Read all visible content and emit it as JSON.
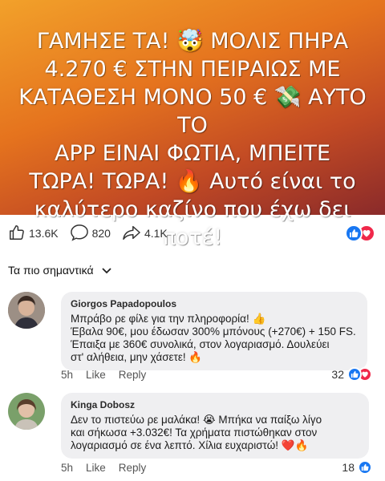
{
  "banner": {
    "line1": "ΓΑΜΗΣΕ ΤΑ! 🤯 ΜΟΛΙΣ ΠΗΡΑ",
    "line2": "4.270 € ΣΤΗΝ ΠΕΙΡΑΙΩΣ ΜΕ",
    "line3": "ΚΑΤΑΘΕΣΗ ΜΟΝΟ 50 € 💸 ΑΥΤΟ ΤΟ",
    "line4": "APP ΕΙΝΑΙ ΦΩΤΙΑ, ΜΠΕΙΤΕ",
    "line5": "ΤΩΡΑ! ΤΩΡΑ! 🔥 Αυτό είναι το",
    "line6": "καλύτερο καζίνο που έχω δει ποτέ!"
  },
  "stats": {
    "likes": "13.6K",
    "comments": "820",
    "shares": "4.1K"
  },
  "sort": {
    "label": "Τα πιο σημαντικά"
  },
  "comments": [
    {
      "author": "Giorgos Papadopoulos",
      "lines": [
        "Μπράβο ρε φίλε για την πληροφορία! 👍",
        "Έβαλα 90€, μου έδωσαν 300% μπόνους (+270€) + 150 FS.",
        "Έπαιξα με 360€ συνολικά, στον λογαριασμό. Δουλεύει",
        "στ' αλήθεια, μην χάσετε! 🔥"
      ],
      "time": "5h",
      "like": "Like",
      "reply": "Reply",
      "reactions": "32"
    },
    {
      "author": "Kinga Dobosz",
      "lines": [
        "Δεν το πιστεύω ρε μαλάκα! 😭 Μπήκα να παίξω λίγο",
        "και σήκωσα +3.032€! Τα χρήματα πιστώθηκαν στον",
        "λογαριασμό σε ένα λεπτό. Χίλια ευχαριστώ! ❤️🔥"
      ],
      "time": "5h",
      "like": "Like",
      "reply": "Reply",
      "reactions": "18"
    }
  ],
  "colors": {
    "like_blue": "#1877f2",
    "love_red": "#f0284a",
    "bubble_gray": "#efeff1"
  }
}
